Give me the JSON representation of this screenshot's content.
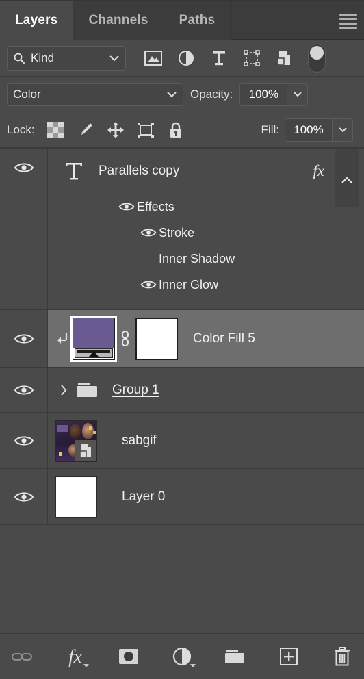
{
  "panel": {
    "tabs": [
      {
        "label": "Layers",
        "active": true
      },
      {
        "label": "Channels",
        "active": false
      },
      {
        "label": "Paths",
        "active": false
      }
    ],
    "menu_icon": "hamburger-menu-icon"
  },
  "filter": {
    "kind_label": "Kind",
    "search_icon": "search-icon",
    "chevron_icon": "chevron-down-icon",
    "type_filters": [
      {
        "name": "filter-pixel-layers-icon"
      },
      {
        "name": "filter-adjustment-layers-icon"
      },
      {
        "name": "filter-type-layers-icon"
      },
      {
        "name": "filter-shape-layers-icon"
      },
      {
        "name": "filter-smart-object-layers-icon"
      }
    ],
    "toggle_name": "filter-enable-toggle"
  },
  "blend": {
    "mode": "Color",
    "opacity_label": "Opacity:",
    "opacity_value": "100%"
  },
  "lock": {
    "label": "Lock:",
    "items": [
      {
        "name": "lock-transparent-pixels-icon"
      },
      {
        "name": "lock-image-pixels-icon"
      },
      {
        "name": "lock-position-icon"
      },
      {
        "name": "lock-artboard-nesting-icon"
      },
      {
        "name": "lock-all-icon"
      }
    ],
    "fill_label": "Fill:",
    "fill_value": "100%"
  },
  "layers": [
    {
      "id": "parallels-copy",
      "name": "Parallels copy",
      "kind": "type",
      "visible": true,
      "selected": false,
      "has_fx": true,
      "fx_label": "fx",
      "effects_expanded": true,
      "effects": [
        {
          "label": "Effects",
          "visible": true,
          "level": 1
        },
        {
          "label": "Stroke",
          "visible": true,
          "level": 2
        },
        {
          "label": "Inner Shadow",
          "visible": false,
          "level": 2
        },
        {
          "label": "Inner Glow",
          "visible": true,
          "level": 2
        }
      ]
    },
    {
      "id": "color-fill-5",
      "name": "Color Fill 5",
      "kind": "solid-color-fill",
      "visible": true,
      "selected": true,
      "clipped": true,
      "fill_color": "#6a5a92",
      "has_mask": true,
      "mask_color": "#ffffff",
      "linked": true
    },
    {
      "id": "group-1",
      "name": "Group 1",
      "kind": "group",
      "visible": true,
      "selected": false,
      "collapsed": true,
      "name_underlined": true
    },
    {
      "id": "sabgif",
      "name": "sabgif",
      "kind": "smart-object",
      "visible": true,
      "selected": false
    },
    {
      "id": "layer-0",
      "name": "Layer 0",
      "kind": "pixel",
      "visible": true,
      "selected": false,
      "thumb_color": "#ffffff"
    }
  ],
  "bottom_bar": [
    {
      "name": "link-layers-icon",
      "enabled": false
    },
    {
      "name": "layer-style-fx-icon",
      "enabled": true
    },
    {
      "name": "add-layer-mask-icon",
      "enabled": true
    },
    {
      "name": "new-adjustment-layer-icon",
      "enabled": true
    },
    {
      "name": "new-group-icon",
      "enabled": true
    },
    {
      "name": "new-layer-icon",
      "enabled": true
    },
    {
      "name": "delete-layer-icon",
      "enabled": true
    }
  ],
  "colors": {
    "panel_bg": "#4a4a4a",
    "tabbar_bg": "#3c3c3c",
    "selected_row": "#6e6e6e",
    "field_bg": "#454545",
    "text": "#f0f0f0",
    "muted_text": "#b6b6b6"
  }
}
